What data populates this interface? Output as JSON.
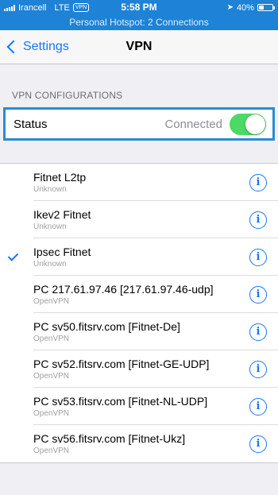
{
  "status_bar": {
    "carrier": "Irancell",
    "network": "LTE",
    "vpn_badge": "VPN",
    "time": "5:58 PM",
    "battery": "40%",
    "battery_level": 0.4,
    "hotspot": "Personal Hotspot: 2 Connections"
  },
  "nav": {
    "back_label": "Settings",
    "title": "VPN"
  },
  "section": {
    "header": "VPN CONFIGURATIONS"
  },
  "status_row": {
    "label": "Status",
    "value": "Connected",
    "toggle_on": true
  },
  "configurations": [
    {
      "name": "Fitnet L2tp",
      "type": "Unknown",
      "selected": false
    },
    {
      "name": "Ikev2 Fitnet",
      "type": "Unknown",
      "selected": false
    },
    {
      "name": "Ipsec Fitnet",
      "type": "Unknown",
      "selected": true
    },
    {
      "name": "PC 217.61.97.46 [217.61.97.46-udp]",
      "type": "OpenVPN",
      "selected": false
    },
    {
      "name": "PC sv50.fitsrv.com [Fitnet-De]",
      "type": "OpenVPN",
      "selected": false
    },
    {
      "name": "PC sv52.fitsrv.com [Fitnet-GE-UDP]",
      "type": "OpenVPN",
      "selected": false
    },
    {
      "name": "PC sv53.fitsrv.com [Fitnet-NL-UDP]",
      "type": "OpenVPN",
      "selected": false
    },
    {
      "name": "PC sv56.fitsrv.com [Fitnet-Ukz]",
      "type": "OpenVPN",
      "selected": false
    }
  ],
  "colors": {
    "accent": "#1677f5",
    "status_bar": "#1e82d6",
    "toggle_on": "#4cd964",
    "highlight_border": "#2a8bd4"
  }
}
